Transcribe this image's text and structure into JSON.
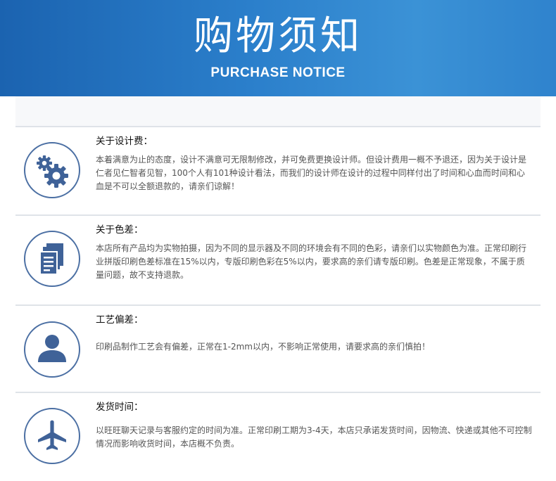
{
  "header": {
    "title": "购物须知",
    "subtitle": "PURCHASE NOTICE"
  },
  "sections": [
    {
      "icon": "gears-icon",
      "title": "关于设计费：",
      "body": "本着满意为止的态度，设计不满意可无限制修改，并可免费更换设计师。但设计费用一概不予退还，因为关于设计是仁者见仁智者见智，100个人有101种设计看法，而我们的设计师在设计的过程中同样付出了时间和心血而时间和心血是不可以全额退款的，请亲们谅解！"
    },
    {
      "icon": "documents-icon",
      "title": "关于色差：",
      "body": "本店所有产品均为实物拍摄，因为不同的显示器及不同的环境会有不同的色彩，请亲们以实物颜色为准。正常印刷行业拼版印刷色差标准在15%以内，专版印刷色彩在5%以内，要求高的亲们请专版印刷。色差是正常现象，不属于质量问题，故不支持退款。"
    },
    {
      "icon": "person-icon",
      "title": "工艺偏差：",
      "body": "印刷品制作工艺会有偏差，正常在1-2mm以内，不影响正常使用，请要求高的亲们慎拍！"
    },
    {
      "icon": "airplane-icon",
      "title": "发货时间：",
      "body": "以旺旺聊天记录与客服约定的时间为准。正常印刷工期为3-4天，本店只承诺发货时间，因物流、快递或其他不可控制情况而影响收货时间，本店概不负责。"
    }
  ],
  "colors": {
    "header_start": "#1b63b0",
    "header_end": "#3b92d6",
    "icon_blue": "#4b6fa3",
    "divider": "#dfe3e8"
  }
}
